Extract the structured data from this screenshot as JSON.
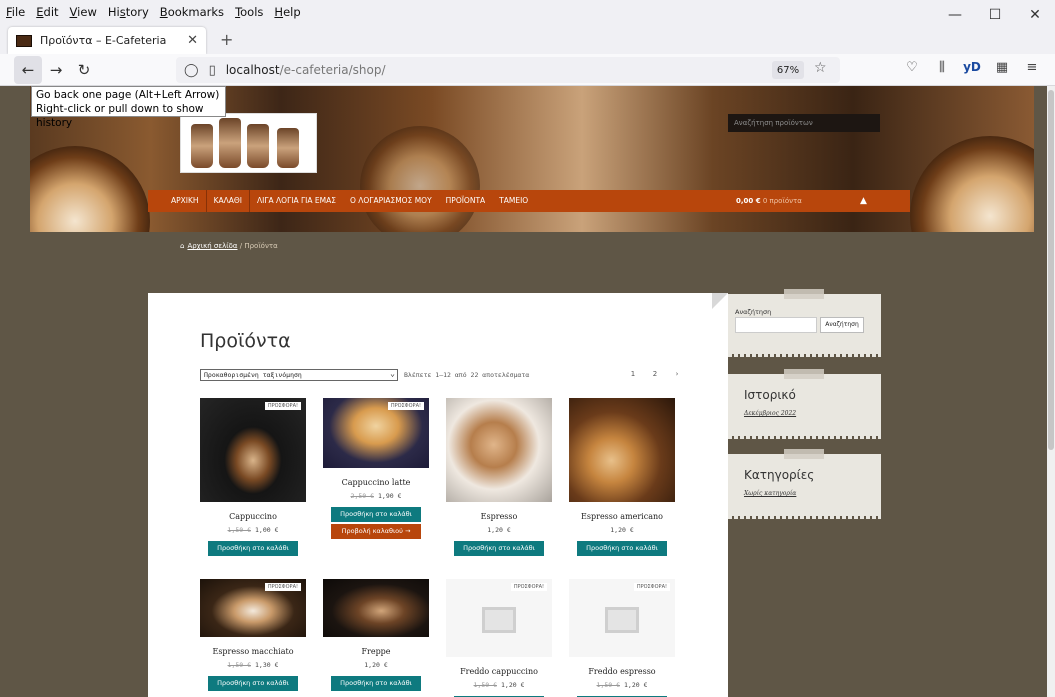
{
  "browser": {
    "menu": [
      "File",
      "Edit",
      "View",
      "History",
      "Bookmarks",
      "Tools",
      "Help"
    ],
    "menu_access": [
      "F",
      "E",
      "V",
      "s",
      "B",
      "T",
      "H"
    ],
    "tab_title": "Προϊόντα – E-Cafeteria",
    "url_host": "localhost",
    "url_path": "/e-cafeteria/shop/",
    "zoom": "67%",
    "tooltip_line1": "Go back one page (Alt+Left Arrow)",
    "tooltip_line2": "Right-click or pull down to show history"
  },
  "site": {
    "search_placeholder": "Αναζήτηση προϊόντων",
    "nav": [
      "ΑΡΧΙΚΗ",
      "ΚΑΛΑΘΙ",
      "ΛΙΓΑ ΛΟΓΙΑ ΓΙΑ ΕΜΑΣ",
      "Ο ΛΟΓΑΡΙΑΣΜΟΣ ΜΟΥ",
      "ΠΡΟΪΟΝΤΑ",
      "ΤΑΜΕΙΟ"
    ],
    "cart_total": "0,00 €",
    "cart_items": "0 προϊόντα",
    "breadcrumb_home": "Αρχική σελίδα",
    "breadcrumb_current": "Προϊόντα"
  },
  "shop": {
    "title": "Προϊόντα",
    "sort_label": "Προκαθορισμένη ταξινόμηση",
    "results": "Βλέπετε 1–12 από 22 αποτελέσματα",
    "pages": [
      "1",
      "2",
      "›"
    ],
    "badge": "ΠΡΟΣΦΟΡΑ!",
    "add_to_cart": "Προσθήκη στο καλάθι",
    "view_cart": "Προβολή καλαθιού →",
    "products": [
      {
        "name": "Cappuccino",
        "old_price": "1,50 €",
        "price": "1,00 €"
      },
      {
        "name": "Cappuccino latte",
        "old_price": "2,50 €",
        "price": "1,90 €"
      },
      {
        "name": "Espresso",
        "old_price": "",
        "price": "1,20 €"
      },
      {
        "name": "Espresso americano",
        "old_price": "",
        "price": "1,20 €"
      },
      {
        "name": "Espresso macchiato",
        "old_price": "1,50 €",
        "price": "1,30 €"
      },
      {
        "name": "Freppe",
        "old_price": "",
        "price": "1,20 €"
      },
      {
        "name": "Freddo cappuccino",
        "old_price": "1,50 €",
        "price": "1,20 €"
      },
      {
        "name": "Freddo espresso",
        "old_price": "1,50 €",
        "price": "1,20 €"
      }
    ]
  },
  "sidebar": {
    "search_label": "Αναζήτηση",
    "search_button": "Αναζήτηση",
    "history_title": "Ιστορικό",
    "history_link": "Δεκέμβριος 2022",
    "categories_title": "Κατηγορίες",
    "categories_link": "Χωρίς κατηγορία"
  },
  "colors": {
    "nav": "#b8460c",
    "button": "#0e7a7f",
    "page_bg": "#5f5646"
  }
}
